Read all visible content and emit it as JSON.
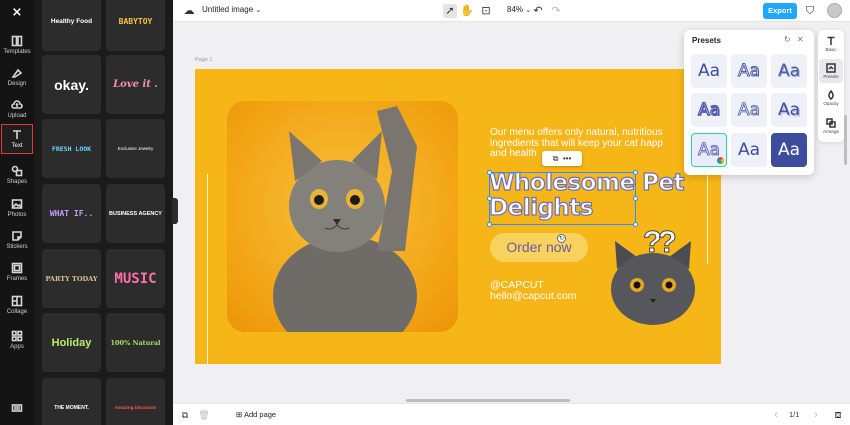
{
  "rail": {
    "items": [
      {
        "label": "Templates",
        "icon": "templates-icon"
      },
      {
        "label": "Design",
        "icon": "design-icon"
      },
      {
        "label": "Upload",
        "icon": "upload-icon"
      },
      {
        "label": "Text",
        "icon": "text-icon"
      },
      {
        "label": "Shapes",
        "icon": "shapes-icon"
      },
      {
        "label": "Photos",
        "icon": "photos-icon"
      },
      {
        "label": "Stickers",
        "icon": "stickers-icon"
      },
      {
        "label": "Frames",
        "icon": "frames-icon"
      },
      {
        "label": "Collage",
        "icon": "collage-icon"
      },
      {
        "label": "Apps",
        "icon": "apps-icon"
      }
    ]
  },
  "text_templates": [
    {
      "text": "Healthy Food",
      "color": "#ffffff"
    },
    {
      "text": "BABYTOY",
      "color": "#f5c542"
    },
    {
      "text": "okay.",
      "color": "#ffffff"
    },
    {
      "text": "Love it .",
      "color": "#f58fb0"
    },
    {
      "text": "FRESH LOOK",
      "color": "#6fd3ff"
    },
    {
      "text": "Exclusive Jewelry",
      "color": "#ffffff"
    },
    {
      "text": "WHAT IF..",
      "color": "#c79bff"
    },
    {
      "text": "BUSINESS AGENCY",
      "color": "#ffffff"
    },
    {
      "text": "PARTY TODAY",
      "color": "#d8c58a"
    },
    {
      "text": "MUSIC",
      "color": "#ff6fa8"
    },
    {
      "text": "Holiday",
      "color": "#b9f06a"
    },
    {
      "text": "100% Natural",
      "color": "#a6e26a"
    },
    {
      "text": "THE MOMENT.",
      "color": "#ffffff"
    },
    {
      "text": "Amazing Discounts",
      "color": "#ff5a4a"
    }
  ],
  "topbar": {
    "title": "Untitled image",
    "zoom": "84%",
    "export_label": "Export"
  },
  "canvas": {
    "page_label": "Page 1",
    "body_copy": "Our menu offers only natural, nutritious\ningredients that will keep your cat happ\nand health",
    "headline": "Wholesome Pet\nDelights",
    "order_button": "Order now",
    "contact": "@CAPCUT\nhello@capcut.com",
    "question_marks": "??",
    "background_color": "#f7b617"
  },
  "presets": {
    "title": "Presets",
    "sample": "Aa"
  },
  "right_toolbar": {
    "items": [
      {
        "label": "Basic",
        "icon": "text-basic-icon"
      },
      {
        "label": "Presets",
        "icon": "presets-icon"
      },
      {
        "label": "Opacity",
        "icon": "opacity-icon"
      },
      {
        "label": "Arrange",
        "icon": "arrange-icon"
      }
    ]
  },
  "bottombar": {
    "add_page": "Add page",
    "page_indicator": "1/1"
  }
}
